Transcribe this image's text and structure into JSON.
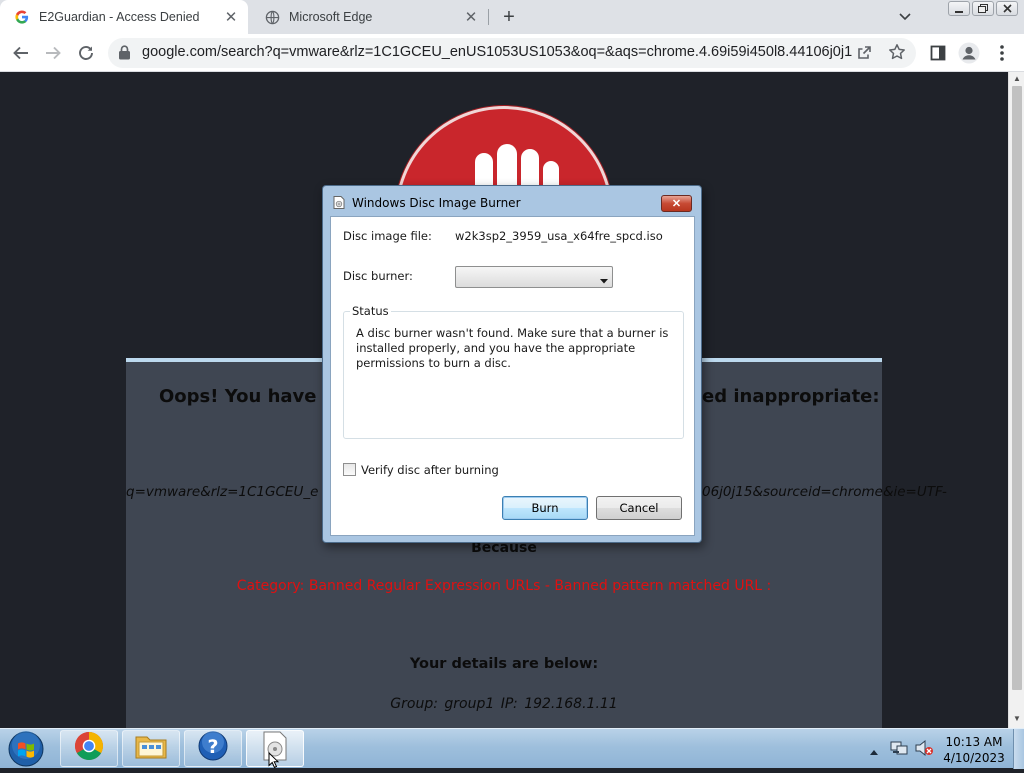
{
  "browser": {
    "tabs": [
      {
        "title": "E2Guardian - Access Denied",
        "favicon": "google-g-icon",
        "active": true
      },
      {
        "title": "Microsoft Edge",
        "favicon": "globe-icon",
        "active": false
      }
    ],
    "url": "google.com/search?q=vmware&rlz=1C1GCEU_enUS1053US1053&oq=&aqs=chrome.4.69i59i450l8.44106j0j15&...",
    "icons": [
      "back-arrow-icon",
      "forward-arrow-icon",
      "reload-icon",
      "lock-icon",
      "share-icon",
      "star-icon",
      "side-panel-icon",
      "profile-icon",
      "menu-icon"
    ]
  },
  "page": {
    "headline_left": "Oops! You have tri",
    "headline_right": "ed inappropriate:",
    "url_left": "q=vmware&rlz=1C1GCEU_e",
    "url_right": "06j0j15&sourceid=chrome&ie=UTF-",
    "because": "Because",
    "category": "Category: Banned Regular Expression URLs - Banned pattern matched URL :",
    "details_heading": "Your details are below:",
    "group_line": "Group: group1   IP: 192.168.1.11",
    "colors": {
      "background": "#1f2229",
      "panel": "#3f4652",
      "category": "#e01010",
      "logo": "#c9262c"
    }
  },
  "dialog": {
    "title": "Windows Disc Image Burner",
    "disc_image_label": "Disc image file:",
    "disc_image_value": "w2k3sp2_3959_usa_x64fre_spcd.iso",
    "disc_burner_label": "Disc burner:",
    "disc_burner_value": "",
    "status_label": "Status",
    "status_message": "A disc burner wasn't found. Make sure that a burner is installed properly, and you have the appropriate permissions to burn a disc.",
    "verify_label": "Verify disc after burning",
    "verify_checked": false,
    "burn_label": "Burn",
    "cancel_label": "Cancel"
  },
  "taskbar": {
    "apps": [
      "chrome-icon",
      "file-explorer-icon",
      "help-icon",
      "disc-burner-icon"
    ],
    "time": "10:13 AM",
    "date": "4/10/2023"
  }
}
